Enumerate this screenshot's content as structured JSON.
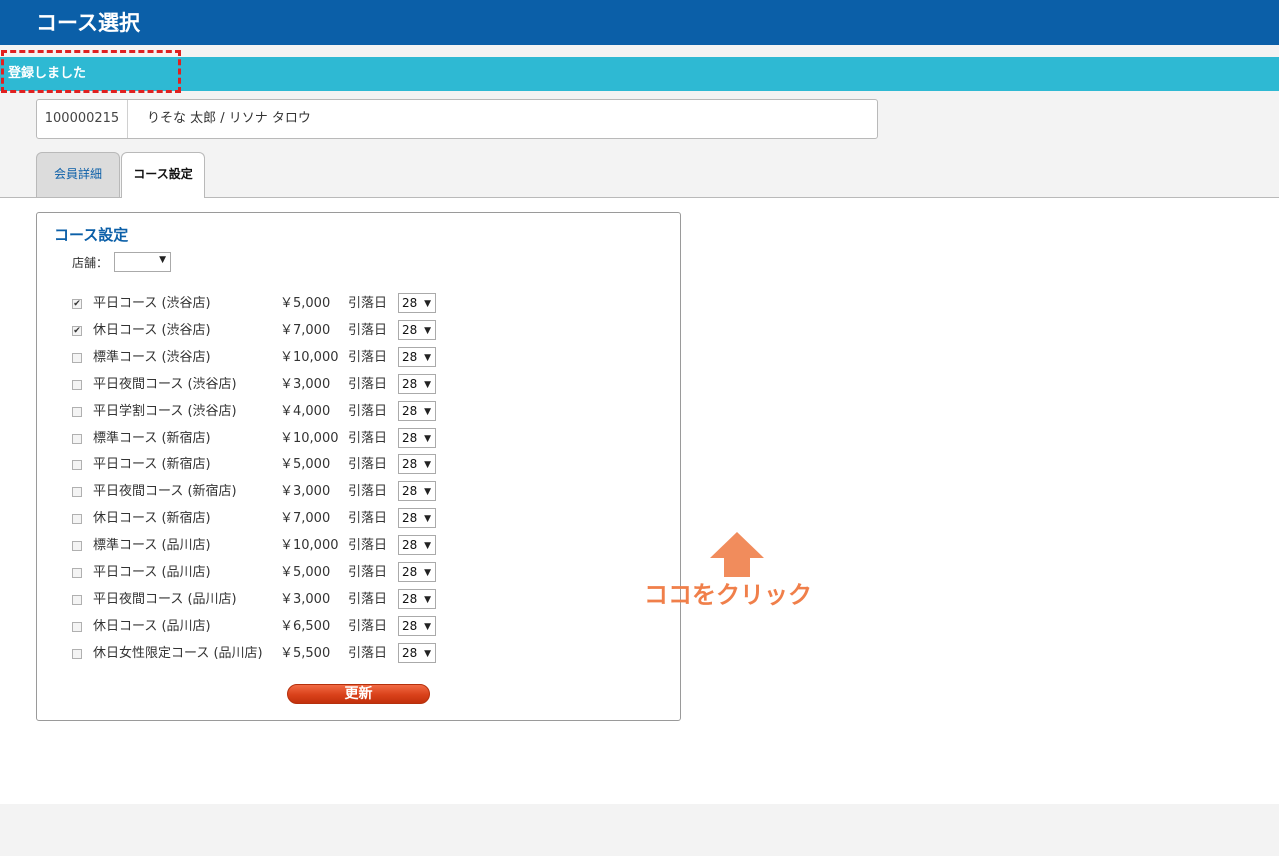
{
  "header": {
    "title": "コース選択"
  },
  "message": {
    "text": "登録しました"
  },
  "member": {
    "id": "100000215",
    "name": "りそな 太郎 / リソナ タロウ"
  },
  "tabs": [
    {
      "label": "会員詳細",
      "active": false
    },
    {
      "label": "コース設定",
      "active": true
    }
  ],
  "panel": {
    "title": "コース設定",
    "store_label": "店舗：",
    "store_value": ""
  },
  "courses": [
    {
      "name": "平日コース (渋谷店)",
      "price": "￥5,000",
      "debit_label": "引落日",
      "debit_day": "28",
      "checked": true
    },
    {
      "name": "休日コース (渋谷店)",
      "price": "￥7,000",
      "debit_label": "引落日",
      "debit_day": "28",
      "checked": true
    },
    {
      "name": "標準コース (渋谷店)",
      "price": "￥10,000",
      "debit_label": "引落日",
      "debit_day": "28",
      "checked": false
    },
    {
      "name": "平日夜間コース (渋谷店)",
      "price": "￥3,000",
      "debit_label": "引落日",
      "debit_day": "28",
      "checked": false
    },
    {
      "name": "平日学割コース (渋谷店)",
      "price": "￥4,000",
      "debit_label": "引落日",
      "debit_day": "28",
      "checked": false
    },
    {
      "name": "標準コース (新宿店)",
      "price": "￥10,000",
      "debit_label": "引落日",
      "debit_day": "28",
      "checked": false
    },
    {
      "name": "平日コース (新宿店)",
      "price": "￥5,000",
      "debit_label": "引落日",
      "debit_day": "28",
      "checked": false
    },
    {
      "name": "平日夜間コース (新宿店)",
      "price": "￥3,000",
      "debit_label": "引落日",
      "debit_day": "28",
      "checked": false
    },
    {
      "name": "休日コース (新宿店)",
      "price": "￥7,000",
      "debit_label": "引落日",
      "debit_day": "28",
      "checked": false
    },
    {
      "name": "標準コース (品川店)",
      "price": "￥10,000",
      "debit_label": "引落日",
      "debit_day": "28",
      "checked": false
    },
    {
      "name": "平日コース (品川店)",
      "price": "￥5,000",
      "debit_label": "引落日",
      "debit_day": "28",
      "checked": false
    },
    {
      "name": "平日夜間コース (品川店)",
      "price": "￥3,000",
      "debit_label": "引落日",
      "debit_day": "28",
      "checked": false
    },
    {
      "name": "休日コース (品川店)",
      "price": "￥6,500",
      "debit_label": "引落日",
      "debit_day": "28",
      "checked": false
    },
    {
      "name": "休日女性限定コース (品川店)",
      "price": "￥5,500",
      "debit_label": "引落日",
      "debit_day": "28",
      "checked": false
    }
  ],
  "update_button": {
    "label": "更新"
  },
  "annotation": {
    "text": "ココをクリック",
    "color": "#f07f4a"
  },
  "colors": {
    "header": "#0b5fa8",
    "message_bar": "#2eb9d3",
    "highlight": "#e02020"
  }
}
